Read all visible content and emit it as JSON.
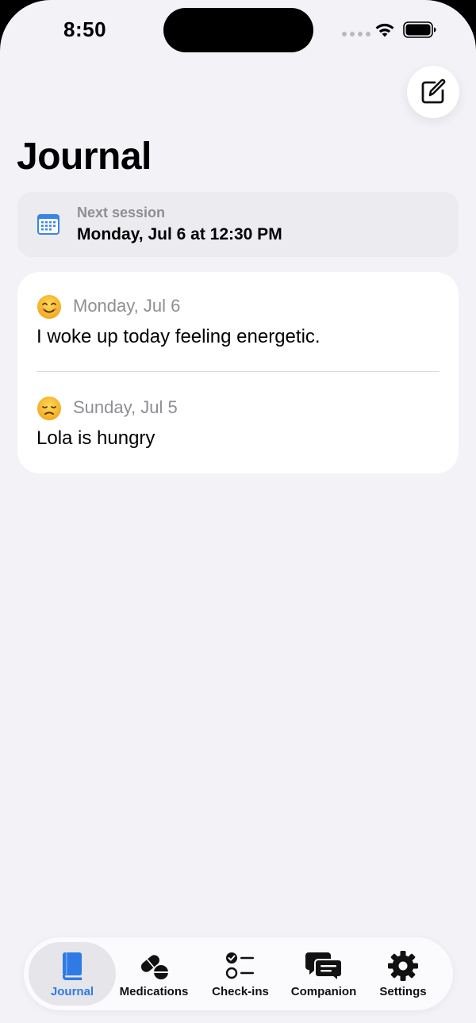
{
  "status_bar": {
    "time": "8:50"
  },
  "header": {
    "title": "Journal",
    "compose_icon": "square-and-pencil-icon"
  },
  "next_session": {
    "label": "Next session",
    "value": "Monday, Jul 6 at 12:30 PM",
    "icon": "calendar-icon"
  },
  "entries": [
    {
      "mood": "smiling-face",
      "date": "Monday, Jul 6",
      "text": "I woke up today feeling energetic."
    },
    {
      "mood": "disappointed-face",
      "date": "Sunday, Jul 5",
      "text": "Lola is hungry"
    }
  ],
  "tab_bar": {
    "tabs": [
      {
        "label": "Journal",
        "icon": "book-icon",
        "active": true
      },
      {
        "label": "Medications",
        "icon": "pills-icon",
        "active": false
      },
      {
        "label": "Check-ins",
        "icon": "checklist-icon",
        "active": false
      },
      {
        "label": "Companion",
        "icon": "chat-bubbles-icon",
        "active": false
      },
      {
        "label": "Settings",
        "icon": "gear-icon",
        "active": false
      }
    ]
  },
  "colors": {
    "accent": "#2f7ae5",
    "background": "#f2f2f7",
    "card": "#ffffff",
    "secondary_text": "#8e8e93"
  }
}
